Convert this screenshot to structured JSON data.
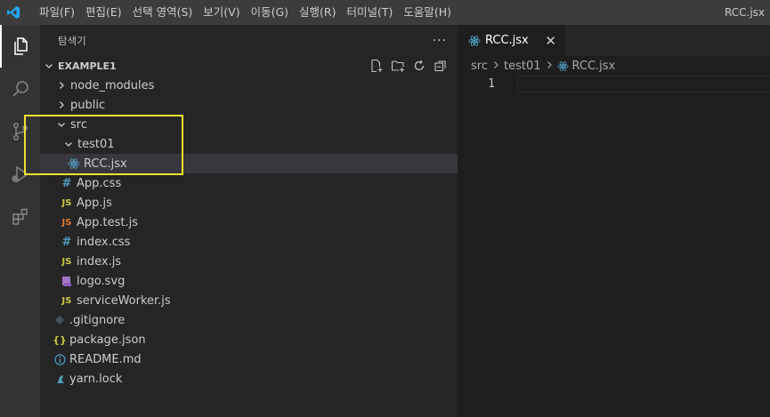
{
  "titlebar": {
    "menu": [
      "파일(F)",
      "편집(E)",
      "선택 영역(S)",
      "보기(V)",
      "이동(G)",
      "실행(R)",
      "터미널(T)",
      "도움말(H)"
    ],
    "window_title": "RCC.jsx"
  },
  "sidebar": {
    "title": "탐색기",
    "section": "EXAMPLE1",
    "tree": [
      {
        "label": "node_modules",
        "kind": "folder-collapsed",
        "depth": 0
      },
      {
        "label": "public",
        "kind": "folder-collapsed",
        "depth": 0
      },
      {
        "label": "src",
        "kind": "folder-open",
        "depth": 0
      },
      {
        "label": "test01",
        "kind": "folder-open",
        "depth": 1
      },
      {
        "label": "RCC.jsx",
        "kind": "react",
        "depth": 2,
        "selected": true
      },
      {
        "label": "App.css",
        "kind": "css",
        "depth": 1
      },
      {
        "label": "App.js",
        "kind": "js",
        "depth": 1
      },
      {
        "label": "App.test.js",
        "kind": "jstest",
        "depth": 1
      },
      {
        "label": "index.css",
        "kind": "css",
        "depth": 1
      },
      {
        "label": "index.js",
        "kind": "js",
        "depth": 1
      },
      {
        "label": "logo.svg",
        "kind": "svg",
        "depth": 1
      },
      {
        "label": "serviceWorker.js",
        "kind": "js",
        "depth": 1
      },
      {
        "label": ".gitignore",
        "kind": "git",
        "depth": 0
      },
      {
        "label": "package.json",
        "kind": "json",
        "depth": 0
      },
      {
        "label": "README.md",
        "kind": "info",
        "depth": 0
      },
      {
        "label": "yarn.lock",
        "kind": "yarn",
        "depth": 0
      }
    ]
  },
  "editor": {
    "tab_label": "RCC.jsx",
    "breadcrumb": [
      "src",
      "test01",
      "RCC.jsx"
    ],
    "line_number": "1"
  },
  "colors": {
    "accent": "#007acc",
    "highlight_box": "#f3e12e",
    "react_icon": "#519aba",
    "js_icon": "#cbcb41",
    "jstest_icon": "#e37933",
    "css_icon": "#519aba",
    "svg_icon": "#a074c4"
  },
  "icons": {
    "activity": [
      "explorer-icon",
      "search-icon",
      "source-control-icon",
      "run-debug-icon",
      "extensions-icon"
    ],
    "section_actions": [
      "new-file-icon",
      "new-folder-icon",
      "refresh-icon",
      "collapse-all-icon"
    ]
  }
}
